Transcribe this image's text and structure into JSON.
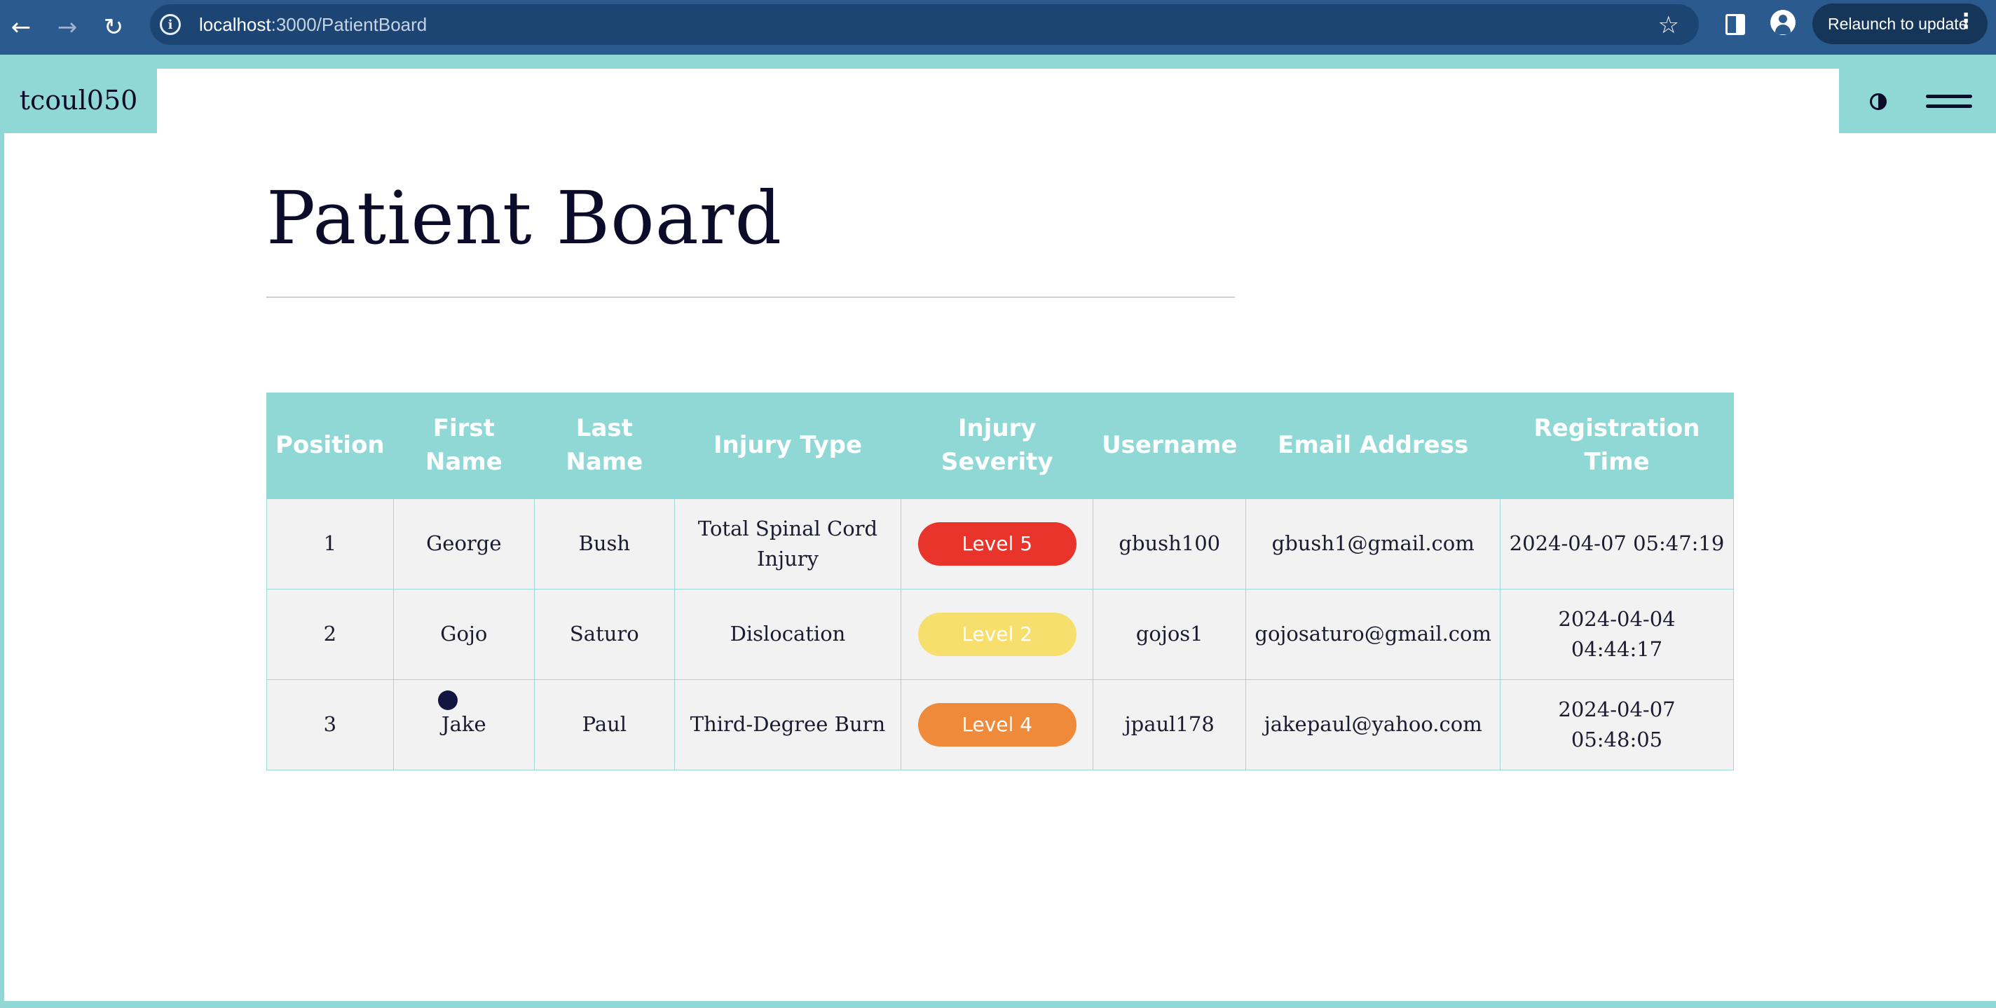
{
  "browser": {
    "url_host": "localhost",
    "url_path": ":3000/PatientBoard",
    "relaunch_label": "Relaunch to update",
    "back_icon": "arrow-left-icon",
    "forward_icon": "arrow-right-icon",
    "reload_icon": "reload-icon",
    "star_icon": "star-icon",
    "menu_dots": "⋮"
  },
  "app": {
    "brand": "tcoul050",
    "theme_icon": "contrast-icon",
    "menu_icon": "hamburger-icon"
  },
  "page": {
    "title": "Patient Board"
  },
  "table": {
    "headers": [
      "Position",
      "First Name",
      "Last Name",
      "Injury Type",
      "Injury Severity",
      "Username",
      "Email Address",
      "Registration Time"
    ],
    "rows": [
      {
        "position": "1",
        "first_name": "George",
        "last_name": "Bush",
        "injury_type": "Total Spinal Cord Injury",
        "severity": "Level 5",
        "username": "gbush100",
        "email": "gbush1@gmail.com",
        "registration": "2024-04-07 05:47:19"
      },
      {
        "position": "2",
        "first_name": "Gojo",
        "last_name": "Saturo",
        "injury_type": "Dislocation",
        "severity": "Level 2",
        "username": "gojos1",
        "email": "gojosaturo@gmail.com",
        "registration": "2024-04-04 04:44:17"
      },
      {
        "position": "3",
        "first_name": "Jake",
        "last_name": "Paul",
        "injury_type": "Third-Degree Burn",
        "severity": "Level 4",
        "username": "jpaul178",
        "email": "jakepaul@yahoo.com",
        "registration": "2024-04-07 05:48:05"
      }
    ]
  },
  "colors": {
    "accent": "#8fd8d6",
    "browser_bar": "#2a5a8e",
    "level_5": "#e8342a",
    "level_4": "#ef8a3a",
    "level_2": "#f7df6e",
    "text_dark": "#0c0c2a"
  }
}
